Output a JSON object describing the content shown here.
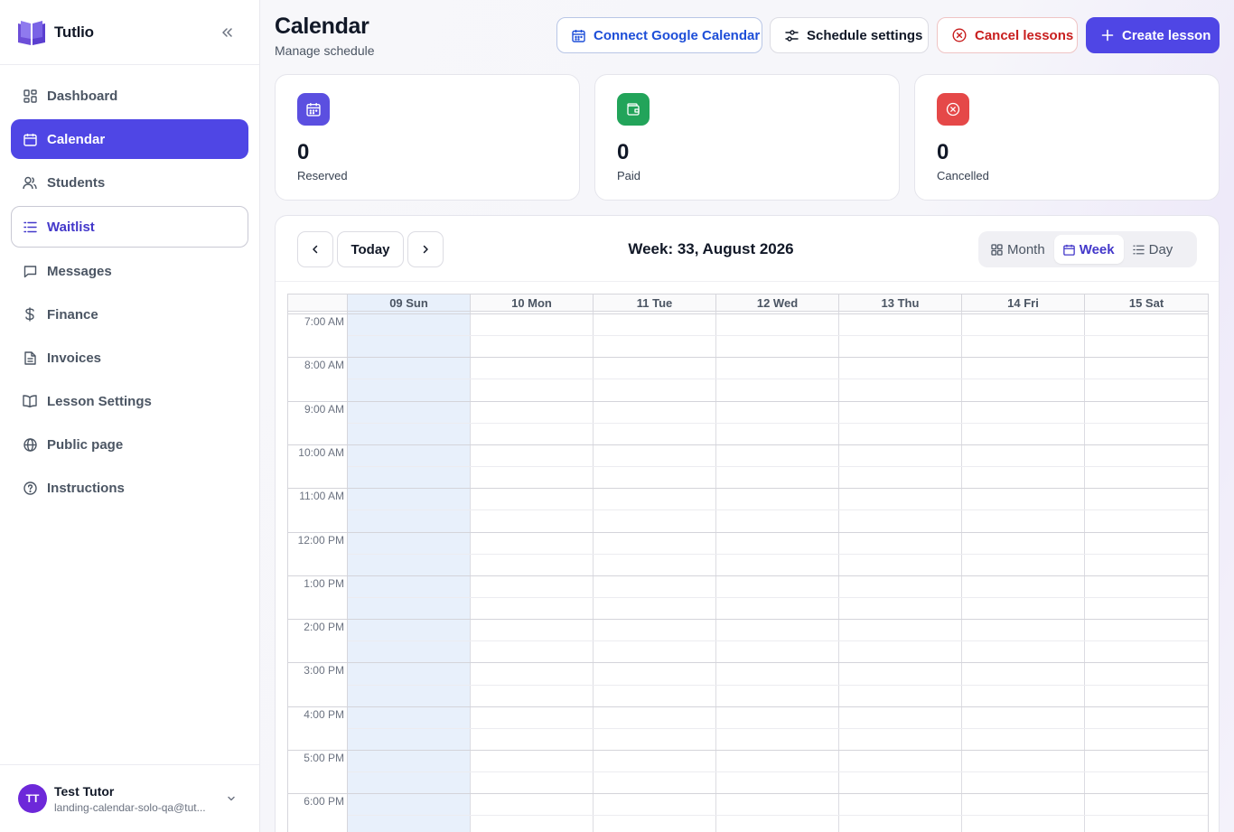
{
  "app": {
    "name": "Tutlio"
  },
  "sidebar": {
    "items": [
      {
        "label": "Dashboard",
        "icon": "dashboard-icon",
        "state": "normal"
      },
      {
        "label": "Calendar",
        "icon": "calendar-icon",
        "state": "active"
      },
      {
        "label": "Students",
        "icon": "users-icon",
        "state": "normal"
      },
      {
        "label": "Waitlist",
        "icon": "list-icon",
        "state": "outlined"
      },
      {
        "label": "Messages",
        "icon": "message-icon",
        "state": "normal"
      },
      {
        "label": "Finance",
        "icon": "dollar-icon",
        "state": "normal"
      },
      {
        "label": "Invoices",
        "icon": "file-icon",
        "state": "normal"
      },
      {
        "label": "Lesson Settings",
        "icon": "book-icon",
        "state": "normal"
      },
      {
        "label": "Public page",
        "icon": "globe-icon",
        "state": "normal"
      },
      {
        "label": "Instructions",
        "icon": "help-circle-icon",
        "state": "normal"
      }
    ]
  },
  "user": {
    "initials": "TT",
    "name": "Test Tutor",
    "email": "landing-calendar-solo-qa@tut..."
  },
  "header": {
    "title": "Calendar",
    "subtitle": "Manage schedule",
    "buttons": {
      "google": "Connect Google Calendar",
      "schedule": "Schedule settings",
      "cancel": "Cancel lessons",
      "create": "Create lesson"
    }
  },
  "stats": [
    {
      "value": "0",
      "label": "Reserved",
      "color": "#5b4fe0",
      "icon": "calendar-icon"
    },
    {
      "value": "0",
      "label": "Paid",
      "color": "#22a45a",
      "icon": "wallet-icon"
    },
    {
      "value": "0",
      "label": "Cancelled",
      "color": "#e54848",
      "icon": "x-circle-icon"
    }
  ],
  "calendar": {
    "today_label": "Today",
    "week_label": "Week: 33, August 2026",
    "views": {
      "month": "Month",
      "week": "Week",
      "day": "Day",
      "selected": "Week"
    },
    "days": [
      "09 Sun",
      "10 Mon",
      "11 Tue",
      "12 Wed",
      "13 Thu",
      "14 Fri",
      "15 Sat"
    ],
    "today_index": 0,
    "hours": [
      "7:00 AM",
      "8:00 AM",
      "9:00 AM",
      "10:00 AM",
      "11:00 AM",
      "12:00 PM",
      "1:00 PM",
      "2:00 PM",
      "3:00 PM",
      "4:00 PM",
      "5:00 PM",
      "6:00 PM"
    ]
  },
  "colors": {
    "accent": "#4f46e5",
    "today_column": "#e8f0fb",
    "danger": "#c81e1e",
    "link": "#1d4ed8"
  }
}
